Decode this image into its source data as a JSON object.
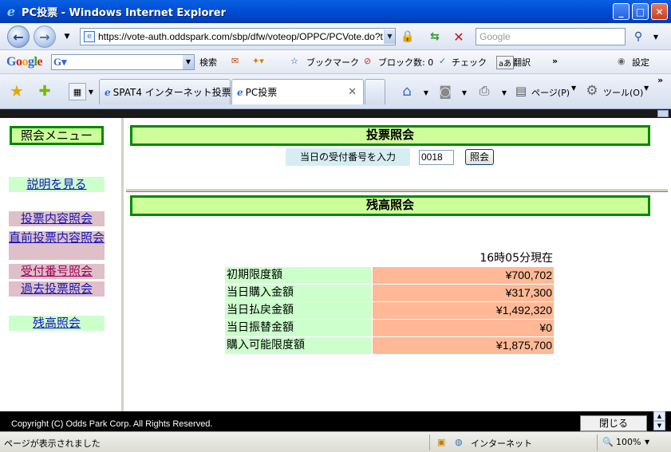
{
  "window": {
    "title": "PC投票 - Windows Internet Explorer"
  },
  "address_bar": {
    "url": "https://vote-auth.oddspark.com/sbp/dfw/voteop/OPPC/PCVote.do?t",
    "search_placeholder": "Google"
  },
  "google_toolbar": {
    "logo": "Google",
    "search_label": "検索",
    "bookmarks_label": "ブックマーク",
    "popup_block_label": "ブロック数: 0",
    "check_label": "チェック",
    "translate_label": "翻訳",
    "settings_label": "設定"
  },
  "tabs": [
    {
      "label": "SPAT4 インターネット投票"
    },
    {
      "label": "PC投票"
    }
  ],
  "command_bar": {
    "page_label": "ページ(P)",
    "tools_label": "ツール(O)"
  },
  "left_menu": {
    "title": "照会メニュー",
    "items": [
      {
        "label": "説明を見る"
      },
      {
        "label": "投票内容照会"
      },
      {
        "label": "直前投票内容照会"
      },
      {
        "label": "受付番号照会"
      },
      {
        "label": "過去投票照会"
      },
      {
        "label": "残高照会"
      }
    ]
  },
  "vote_lookup": {
    "heading": "投票照会",
    "prompt": "当日の受付番号を入力",
    "input_value": "0018",
    "button_label": "照会"
  },
  "balance": {
    "heading": "残高照会",
    "as_of": "16時05分現在",
    "rows": [
      {
        "label": "初期限度額",
        "value": "¥700,702"
      },
      {
        "label": "当日購入金額",
        "value": "¥317,300"
      },
      {
        "label": "当日払戻金額",
        "value": "¥1,492,320"
      },
      {
        "label": "当日振替金額",
        "value": "¥0"
      },
      {
        "label": "購入可能限度額",
        "value": "¥1,875,700"
      }
    ]
  },
  "footer": {
    "copyright": "Copyright (C) Odds Park Corp. All Rights Reserved.",
    "close_label": "閉じる"
  },
  "status_bar": {
    "message": "ページが表示されました",
    "zone": "インターネット",
    "zoom": "100%"
  },
  "colors": {
    "menu_green": "#ccffcc",
    "menu_pink": "#dfc0c8",
    "header_green": "#ccff99",
    "header_border": "#008a00",
    "value_salmon": "#ffb996"
  }
}
